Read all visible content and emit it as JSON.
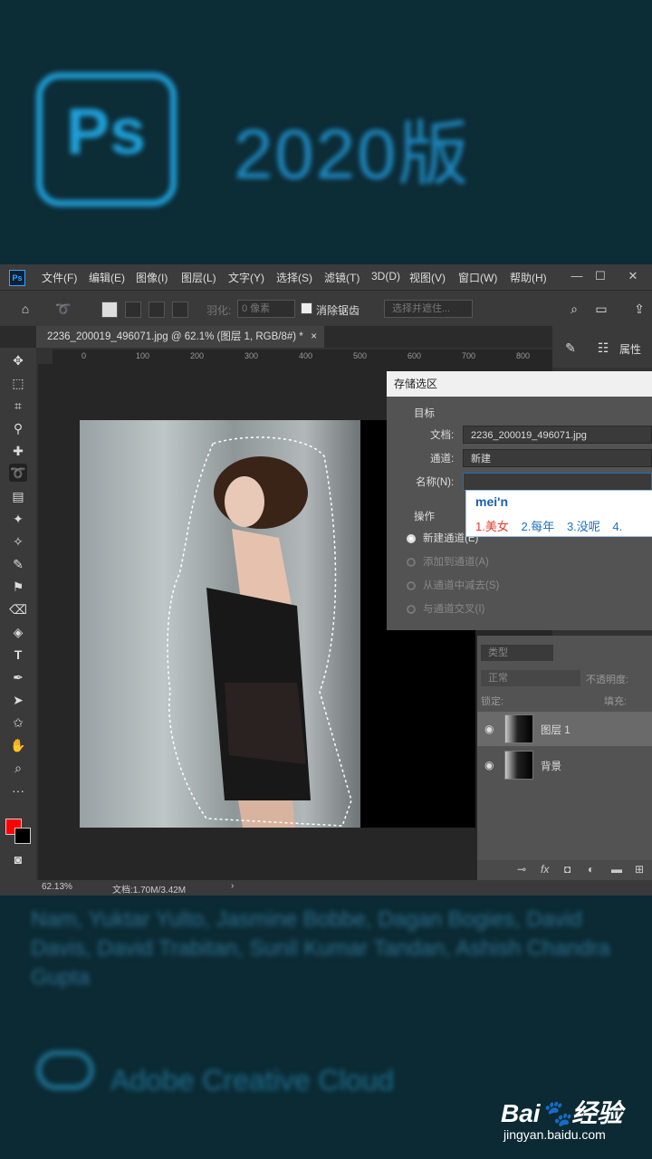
{
  "splash": {
    "logo_text": "Ps",
    "title": "2020版",
    "credits": "Nam, Yuktar Yulto, Jasmine Bobbe, Dagan Bogies, David Davis, David Trabitan, Sunil Kumar Tandan, Ashish Chandra Gupta",
    "cc_text": "Adobe Creative Cloud"
  },
  "app": {
    "badge": "Ps",
    "menus": [
      "文件(F)",
      "编辑(E)",
      "图像(I)",
      "图层(L)",
      "文字(Y)",
      "选择(S)",
      "滤镜(T)",
      "3D(D)",
      "视图(V)",
      "窗口(W)",
      "帮助(H)"
    ],
    "window_buttons": [
      "—",
      "☐",
      "✕"
    ],
    "options": {
      "feather_label": "羽化:",
      "feather_value": "0 像素",
      "antialias_label": "消除锯齿",
      "select_mask": "选择并遮住..."
    },
    "tab": "2236_200019_496071.jpg @ 62.1% (图层 1, RGB/8#) *",
    "tab_close": "×",
    "ruler_ticks": [
      "0",
      "100",
      "200",
      "300",
      "400",
      "500",
      "600",
      "700",
      "800"
    ],
    "status": {
      "zoom": "62.13%",
      "doc": "文档:1.70M/3.42M",
      "arrow": "›"
    },
    "panel_tabs": {
      "properties": "属性"
    },
    "colors": {
      "foreground": "#ff0000",
      "background": "#000000"
    }
  },
  "dialog": {
    "title": "存储选区",
    "target_section": "目标",
    "doc_label": "文档:",
    "doc_value": "2236_200019_496071.jpg",
    "channel_label": "通道:",
    "channel_value": "新建",
    "name_label": "名称(N):",
    "name_value": "",
    "operation_section": "操作",
    "ops": [
      "新建通道(E)",
      "添加到通道(A)",
      "从通道中减去(S)",
      "与通道交叉(I)"
    ]
  },
  "ime": {
    "input": "mei'n",
    "candidates": [
      "1.美女",
      "2.每年",
      "3.没呢",
      "4."
    ]
  },
  "layers": {
    "search_placeholder": "类型",
    "blend_mode": "正常",
    "opacity_label": "不透明度:",
    "lock_label": "锁定:",
    "fill_label": "填充:",
    "items": [
      {
        "name": "图层 1"
      },
      {
        "name": "背景"
      }
    ],
    "footer_icons": [
      "link-icon",
      "fx-icon",
      "mask-icon",
      "adjustment-icon",
      "folder-icon",
      "new-layer-icon"
    ]
  },
  "watermark": {
    "logo": "Bai🐾经验",
    "site": "jingyan.baidu.com"
  }
}
